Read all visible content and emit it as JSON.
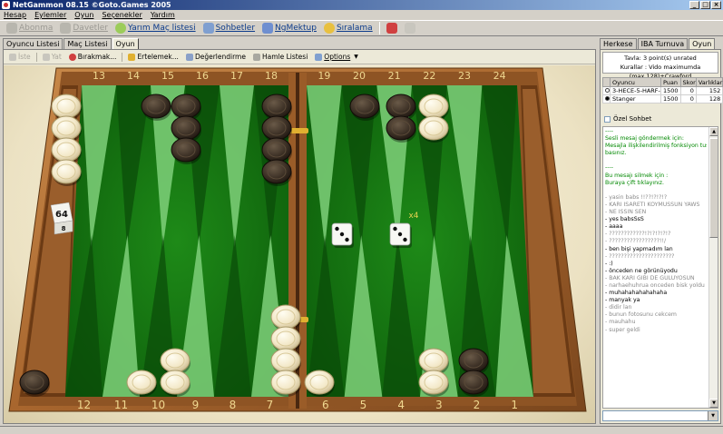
{
  "window": {
    "title": "NetGammon 08.15 ©Goto.Games 2005"
  },
  "menu": [
    "Hesap",
    "Eylemler",
    "Oyun",
    "Seçenekler",
    "Yardım"
  ],
  "toolbar": {
    "buttons": [
      {
        "label": "Abonma",
        "icon": "user-icon",
        "enabled": false
      },
      {
        "label": "Davetler",
        "icon": "invite-icon",
        "enabled": false
      },
      {
        "label": "Yarım Maç listesi",
        "icon": "list-icon",
        "enabled": true
      },
      {
        "label": "Sohbetler",
        "icon": "chat-icon",
        "enabled": true
      },
      {
        "label": "NgMektup",
        "icon": "mail-icon",
        "enabled": true
      },
      {
        "label": "Sıralama",
        "icon": "trophy-icon",
        "enabled": true
      }
    ]
  },
  "left_tabs": [
    "Oyuncu Listesi",
    "Maç Listesi",
    "Oyun"
  ],
  "right_tabs": [
    "Herkese",
    "IBA Turnuva",
    "Oyun"
  ],
  "game_toolbar": [
    {
      "label": "İste",
      "enabled": false
    },
    {
      "label": "Yat",
      "enabled": false
    },
    {
      "label": "Bırakmak...",
      "enabled": true
    },
    {
      "label": "Ertelemek...",
      "enabled": true
    },
    {
      "label": "Değerlendirme",
      "enabled": true
    },
    {
      "label": "Hamle Listesi",
      "enabled": true
    },
    {
      "label": "Options",
      "enabled": true
    }
  ],
  "board": {
    "top_labels": [
      "13",
      "14",
      "15",
      "16",
      "17",
      "18",
      "19",
      "20",
      "21",
      "22",
      "23",
      "24"
    ],
    "bottom_labels": [
      "12",
      "11",
      "10",
      "9",
      "8",
      "7",
      "6",
      "5",
      "4",
      "3",
      "2",
      "1"
    ],
    "cube_value": "64",
    "cube_small": "8",
    "dice": [
      3,
      3
    ],
    "dice_multiplier": "x4"
  },
  "match": {
    "line1": "Tavla: 3 point(s) unrated",
    "line2": "Kurallar : Vido maximumda (max.128)+Crawford"
  },
  "players": {
    "headers": [
      "Oyuncu",
      "Puan",
      "Skor",
      "Varlıklar"
    ],
    "rows": [
      {
        "color": "white",
        "name": "3-HECE-5-HARF-B",
        "rating": "1500",
        "score": "0",
        "assets": "152"
      },
      {
        "color": "black",
        "name": "Stanger",
        "rating": "1500",
        "score": "0",
        "assets": "128"
      }
    ]
  },
  "private_chat_label": "Özel Sohbet",
  "chat": [
    {
      "t": "----",
      "c": "g"
    },
    {
      "t": "Sesli mesaj göndermek için:",
      "c": "g"
    },
    {
      "t": "Mesajla ilişkilendirilmiş fonksiyon tuşuna",
      "c": "g"
    },
    {
      "t": "basınız.",
      "c": "g"
    },
    {
      "t": "",
      "c": "g"
    },
    {
      "t": "----",
      "c": "g"
    },
    {
      "t": "Bu mesajı silmek için :",
      "c": "g"
    },
    {
      "t": "Buraya çift tıklayınız.",
      "c": "g"
    },
    {
      "t": "",
      "c": "g"
    },
    {
      "t": "- yasin babs !!??!?!?!?",
      "c": "gr"
    },
    {
      "t": "- KARI ISARETI KOYMUSSUN YAWS",
      "c": "gr"
    },
    {
      "t": "- NE ISSIN SEN",
      "c": "gr"
    },
    {
      "t": "- yes babsSsS",
      "c": "k"
    },
    {
      "t": "- aaaa",
      "c": "k"
    },
    {
      "t": "- ????????????!?!?!?!?!?",
      "c": "gr"
    },
    {
      "t": "- ?????????????????!!/",
      "c": "gr"
    },
    {
      "t": "- ben bişi yapmadım lan",
      "c": "k"
    },
    {
      "t": "- ??????????????????????",
      "c": "gr"
    },
    {
      "t": "- :)",
      "c": "k"
    },
    {
      "t": "- önceden ne görünüyodu",
      "c": "k"
    },
    {
      "t": "- BAK KARI GIBI DE GULUYOSUN",
      "c": "gr"
    },
    {
      "t": "- narhaehuhrua onceden bisk yoldu",
      "c": "gr"
    },
    {
      "t": "- muhahahahahahaha",
      "c": "k"
    },
    {
      "t": "- manyak ya",
      "c": "k"
    },
    {
      "t": "- didir lan",
      "c": "gr"
    },
    {
      "t": "- bunun fotosunu cekcem",
      "c": "gr"
    },
    {
      "t": "- mauhahu",
      "c": "gr"
    },
    {
      "t": "- super geldi",
      "c": "gr"
    }
  ]
}
